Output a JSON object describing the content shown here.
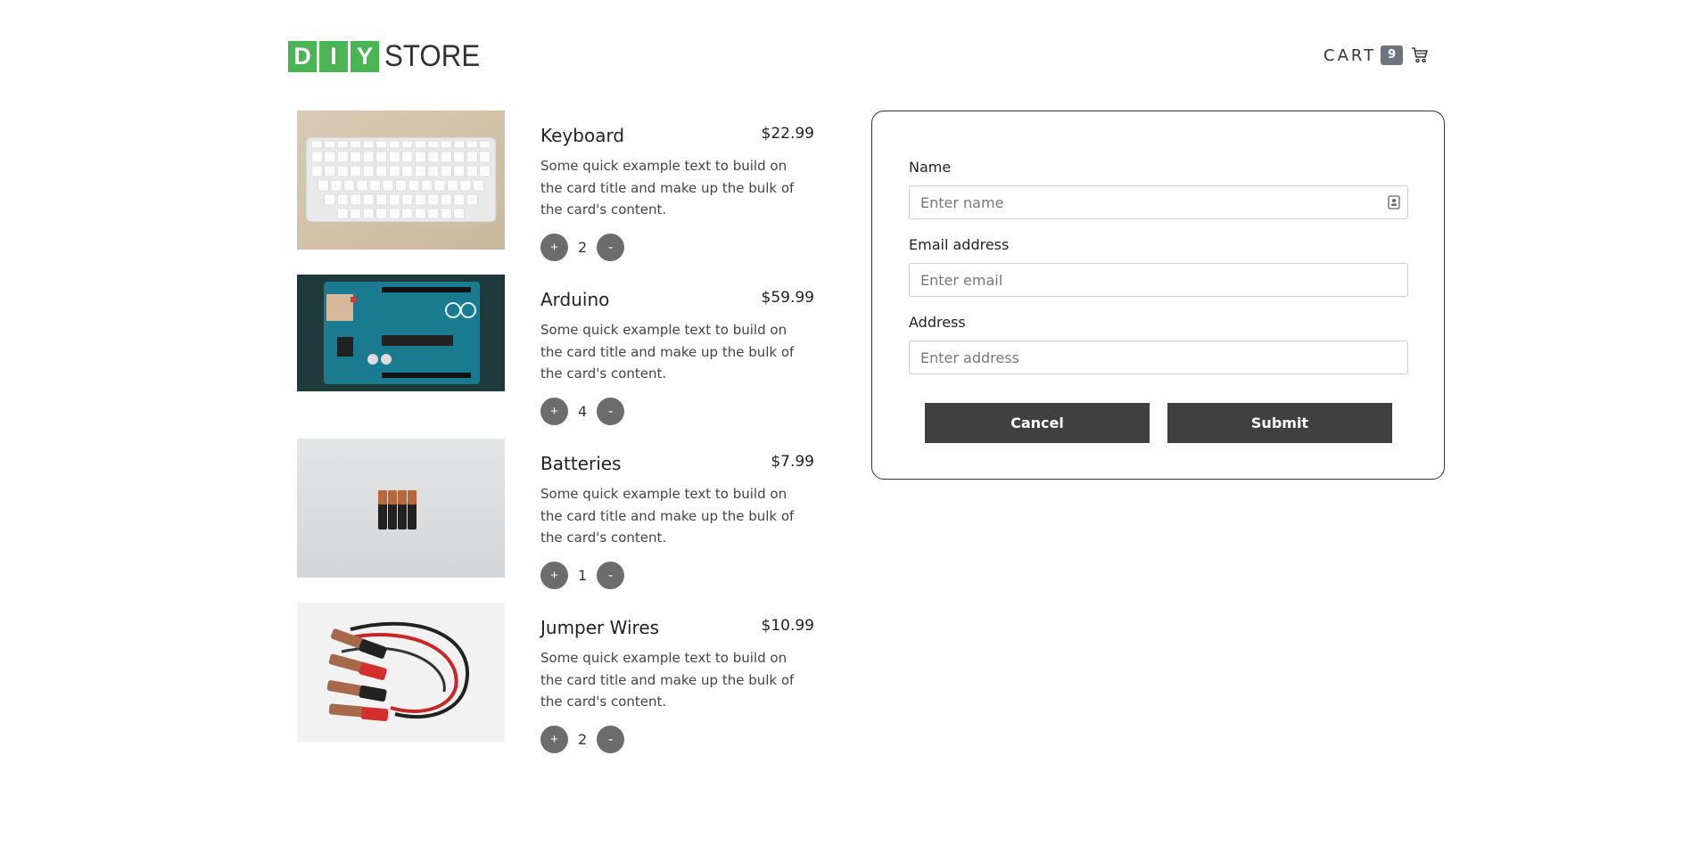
{
  "brand": {
    "letters": [
      "D",
      "I",
      "Y"
    ],
    "word": "STORE",
    "accent_color": "#4bb556"
  },
  "cart": {
    "label": "CART",
    "count": "9",
    "icon": "shopping-cart-icon"
  },
  "products": [
    {
      "name": "Keyboard",
      "price": "$22.99",
      "description": "Some quick example text to build on the card title and make up the bulk of the card's content.",
      "quantity": "2",
      "plus_label": "+",
      "minus_label": "-"
    },
    {
      "name": "Arduino",
      "price": "$59.99",
      "description": "Some quick example text to build on the card title and make up the bulk of the card's content.",
      "quantity": "4",
      "plus_label": "+",
      "minus_label": "-"
    },
    {
      "name": "Batteries",
      "price": "$7.99",
      "description": "Some quick example text to build on the card title and make up the bulk of the card's content.",
      "quantity": "1",
      "plus_label": "+",
      "minus_label": "-"
    },
    {
      "name": "Jumper Wires",
      "price": "$10.99",
      "description": "Some quick example text to build on the card title and make up the bulk of the card's content.",
      "quantity": "2",
      "plus_label": "+",
      "minus_label": "-"
    }
  ],
  "form": {
    "name_label": "Name",
    "name_placeholder": "Enter name",
    "email_label": "Email address",
    "email_placeholder": "Enter email",
    "address_label": "Address",
    "address_placeholder": "Enter address",
    "cancel_label": "Cancel",
    "submit_label": "Submit",
    "button_color": "#404040"
  }
}
